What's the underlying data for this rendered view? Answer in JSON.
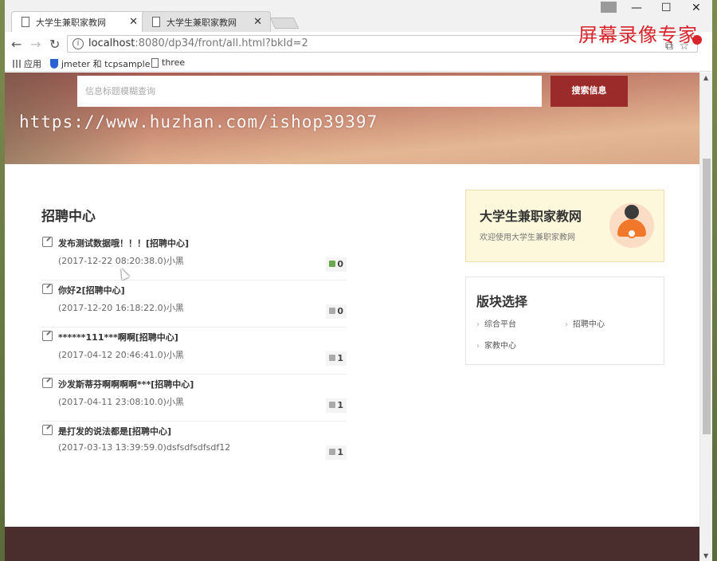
{
  "browser": {
    "tabs": [
      {
        "title": "大学生兼职家教网",
        "active": true
      },
      {
        "title": "大学生兼职家教网",
        "active": false
      }
    ],
    "url_host": "localhost",
    "url_rest": ":8080/dp34/front/all.html?bkId=2",
    "bookmarks": [
      {
        "label": "应用",
        "icon": "apps-icon"
      },
      {
        "label": "jmeter 和 tcpsample",
        "icon": "shield-icon"
      },
      {
        "label": "three",
        "icon": "file-icon"
      }
    ],
    "watermark_text": "屏幕录像专家"
  },
  "hero": {
    "search_placeholder": "信息标题模糊查询",
    "search_button": "搜索信息",
    "url_watermark": "https://www.huzhan.com/ishop39397"
  },
  "main": {
    "section_title": "招聘中心",
    "posts": [
      {
        "title": "发布测试数据哦！！！[招聘中心]",
        "meta": "(2017-12-22 08:20:38.0)小黑",
        "likes": "0",
        "liked": true
      },
      {
        "title": "你好2[招聘中心]",
        "meta": "(2017-12-20 16:18:22.0)小黑",
        "likes": "0",
        "liked": false
      },
      {
        "title": "******111***啊啊[招聘中心]",
        "meta": "(2017-04-12 20:46:41.0)小黑",
        "likes": "1",
        "liked": false
      },
      {
        "title": "沙发斯蒂芬啊啊啊啊***[招聘中心]",
        "meta": "(2017-04-11 23:08:10.0)小黑",
        "likes": "1",
        "liked": false
      },
      {
        "title": "是打发的说法都是[招聘中心]",
        "meta": "(2017-03-13 13:39:59.0)dsfsdfsdfsdf12",
        "likes": "1",
        "liked": false
      }
    ]
  },
  "sidebar": {
    "site_title": "大学生兼职家教网",
    "welcome": "欢迎使用大学生兼职家教网",
    "board_title": "版块选择",
    "boards": [
      "综合平台",
      "招聘中心",
      "家教中心"
    ]
  },
  "colors": {
    "accent": "#9b2a2a",
    "footer": "#4a2e2d",
    "card_bg": "#fdf7dc",
    "like_active": "#6aa84f"
  }
}
